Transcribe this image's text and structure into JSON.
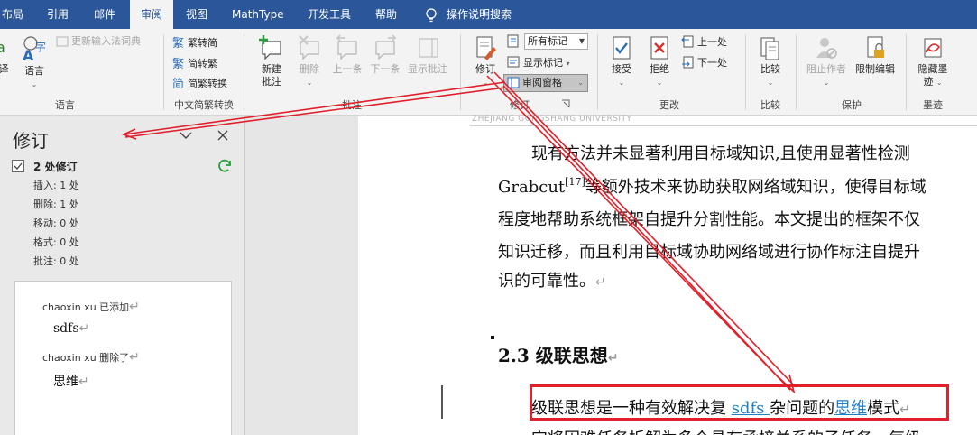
{
  "tabs": [
    {
      "label": "布局",
      "active": false
    },
    {
      "label": "引用",
      "active": false
    },
    {
      "label": "邮件",
      "active": false
    },
    {
      "label": "审阅",
      "active": true
    },
    {
      "label": "视图",
      "active": false
    },
    {
      "label": "MathType",
      "active": false
    },
    {
      "label": "开发工具",
      "active": false
    },
    {
      "label": "帮助",
      "active": false
    }
  ],
  "tell_me": "操作说明搜索",
  "ribbon": {
    "language": {
      "translate_label": "译",
      "language_label": "语言",
      "update_ime": "更新输入法词典",
      "group_label": "语言"
    },
    "chinese_conversion": {
      "to_simplified": "繁转简",
      "to_traditional": "简转繁",
      "conversion": "简繁转换",
      "group_label": "中文简繁转换"
    },
    "comments": {
      "new_comment": "新建\n批注",
      "new_comment_line1": "新建",
      "new_comment_line2": "批注",
      "delete": "删除",
      "previous": "上一条",
      "next": "下一条",
      "show_comments": "显示批注",
      "group_label": "批注"
    },
    "tracking": {
      "track_changes": "修订",
      "markup_select": "所有标记",
      "show_markup": "显示标记",
      "reviewing_pane": "审阅窗格",
      "group_label": "修订"
    },
    "changes": {
      "accept": "接受",
      "reject": "拒绝",
      "previous": "上一处",
      "next": "下一处",
      "group_label": "更改"
    },
    "compare": {
      "compare": "比较",
      "group_label": "比较"
    },
    "protect": {
      "block_authors": "阻止作者",
      "restrict_editing": "限制编辑",
      "group_label": "保护"
    },
    "ink": {
      "hide_ink_line1": "隐藏墨",
      "hide_ink_line2": "迹",
      "group_label": "墨迹"
    }
  },
  "pane": {
    "title": "修订",
    "summary": "2 处修订",
    "stats": [
      "插入: 1 处",
      "删除: 1 处",
      "移动: 0 处",
      "格式: 0 处",
      "批注: 0 处"
    ],
    "revisions": [
      {
        "author_line": "chaoxin xu  已添加",
        "text": "sdfs"
      },
      {
        "author_line": "chaoxin xu  删除了",
        "text": "思维"
      }
    ]
  },
  "document": {
    "header": "ZHEJIANG GONGSHANG UNIVERSITY",
    "para_lines": [
      "现有方法并未显著利用目标域知识,且使用显著性检测",
      "等额外技术来协助获取网络域知识，使得目标域",
      "程度地帮助系统框架自提升分割性能。本文提出的框架不仅",
      "知识迁移，而且利用目标域协助网络域进行协作标注自提升",
      "识的可靠性。"
    ],
    "line2_prefix": "Grabcut",
    "line2_sup": "[17]",
    "heading": "2.3 级联思想",
    "track_line_before": "级联思想是一种有效解决复 ",
    "track_inserted": "sdfs ",
    "track_middle": "杂问题的",
    "track_deleted": "思维",
    "track_after": "模式",
    "next_line": "它将困难任务拆解为多个具有承接关系的子任务，每级"
  },
  "colors": {
    "ribbon_blue": "#2b579a",
    "revision_blue": "#1f7fc4",
    "annotation_red": "#e0202a"
  }
}
